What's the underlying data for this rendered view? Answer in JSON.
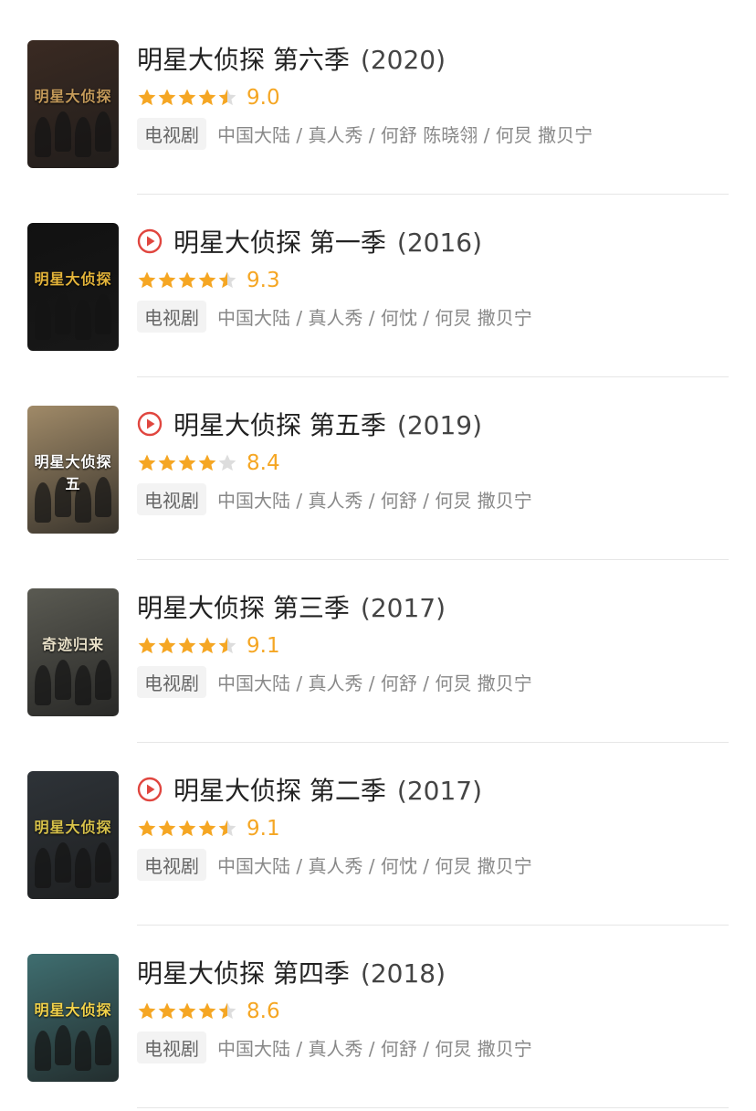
{
  "colors": {
    "star_on": "#f5a623",
    "star_off": "#dddddd",
    "play_icon": "#e0463f",
    "tag_bg": "#f3f3f3"
  },
  "items": [
    {
      "title": "明星大侦探 第六季",
      "year": "(2020)",
      "has_play": false,
      "rating": "9.0",
      "stars": 4.5,
      "tag": "电视剧",
      "meta": "中国大陆 / 真人秀 / 何舒 陈晓翎 / 何炅 撒贝宁",
      "poster_text": "明星大侦探",
      "poster_bg": "#3a2a22",
      "poster_accent": "#c59b5a"
    },
    {
      "title": "明星大侦探 第一季",
      "year": "(2016)",
      "has_play": true,
      "rating": "9.3",
      "stars": 4.5,
      "tag": "电视剧",
      "meta": "中国大陆 / 真人秀 / 何忱 / 何炅 撒贝宁",
      "poster_text": "明星大侦探",
      "poster_bg": "#111111",
      "poster_accent": "#e5b53a"
    },
    {
      "title": "明星大侦探 第五季",
      "year": "(2019)",
      "has_play": true,
      "rating": "8.4",
      "stars": 4,
      "tag": "电视剧",
      "meta": "中国大陆 / 真人秀 / 何舒 / 何炅 撒贝宁",
      "poster_text": "明星大侦探五",
      "poster_bg": "#a08a68",
      "poster_accent": "#ffffff"
    },
    {
      "title": "明星大侦探 第三季",
      "year": "(2017)",
      "has_play": false,
      "rating": "9.1",
      "stars": 4.5,
      "tag": "电视剧",
      "meta": "中国大陆 / 真人秀 / 何舒 / 何炅 撒贝宁",
      "poster_text": "奇迹归来",
      "poster_bg": "#5a5a52",
      "poster_accent": "#e8e0c8"
    },
    {
      "title": "明星大侦探 第二季",
      "year": "(2017)",
      "has_play": true,
      "rating": "9.1",
      "stars": 4.5,
      "tag": "电视剧",
      "meta": "中国大陆 / 真人秀 / 何忱 / 何炅 撒贝宁",
      "poster_text": "明星大侦探",
      "poster_bg": "#2e3338",
      "poster_accent": "#d8c24a"
    },
    {
      "title": "明星大侦探 第四季",
      "year": "(2018)",
      "has_play": false,
      "rating": "8.6",
      "stars": 4.5,
      "tag": "电视剧",
      "meta": "中国大陆 / 真人秀 / 何舒 / 何炅 撒贝宁",
      "poster_text": "明星大侦探",
      "poster_bg": "#3f6e70",
      "poster_accent": "#f2d24a"
    }
  ]
}
